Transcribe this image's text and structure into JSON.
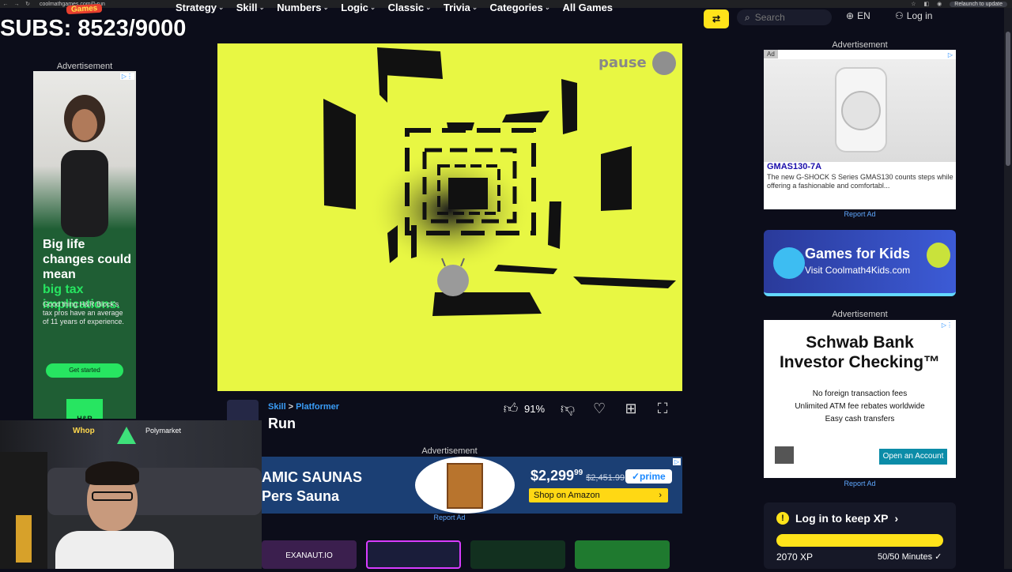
{
  "browser": {
    "url": "coolmathgames.com/0-run",
    "relaunch": "Relaunch to update"
  },
  "header": {
    "logo": "Games",
    "nav": [
      {
        "label": "Strategy"
      },
      {
        "label": "Skill"
      },
      {
        "label": "Numbers"
      },
      {
        "label": "Logic"
      },
      {
        "label": "Classic"
      },
      {
        "label": "Trivia"
      },
      {
        "label": "Categories"
      }
    ],
    "all_games": "All Games",
    "search_placeholder": "Search",
    "language": "EN",
    "login": "Log in"
  },
  "overlay": {
    "subs": "SUBS: 8523/9000"
  },
  "left_ad": {
    "label": "Advertisement",
    "headline_white": "Big life changes could mean",
    "headline_green": "big tax implications.",
    "body": "Good thing H&R Block's tax pros have an average of 11 years of experience.",
    "cta": "Get started",
    "brand": "H&R"
  },
  "game": {
    "pause_label": "pause",
    "breadcrumb_category": "Skill",
    "breadcrumb_sep": ">",
    "breadcrumb_sub": "Platformer",
    "title": "Run",
    "rating": "91%"
  },
  "mid_ad": {
    "label": "Advertisement",
    "headline": "AMIC SAUNAS Pers Sauna",
    "price_main": "$2,299",
    "price_cents": "99",
    "price_old": "$2,451.99",
    "prime": "✓prime",
    "shop": "Shop on Amazon",
    "report": "Report Ad"
  },
  "right_ad1": {
    "label": "Advertisement",
    "tag": "Ad",
    "name": "GMAS130-7A",
    "desc": "The new G-SHOCK S Series GMAS130 counts steps while offering a fashionable and comfortabl...",
    "report": "Report Ad"
  },
  "kids": {
    "title": "Games for Kids",
    "subtitle": "Visit Coolmath4Kids.com"
  },
  "right_ad2": {
    "label": "Advertisement",
    "headline1": "Schwab Bank",
    "headline2": "Investor Checking™",
    "lines": [
      "No foreign transaction fees",
      "Unlimited ATM fee rebates worldwide",
      "Easy cash transfers"
    ],
    "cta": "Open an Account",
    "report": "Report Ad"
  },
  "xp": {
    "title": "Log in to keep XP",
    "icon": "!",
    "points": "2070 XP",
    "minutes": "50/50 Minutes ✓",
    "progress": 1.0
  },
  "webcam": {
    "sponsor1": "Whop",
    "sponsor2": "Polymarket"
  },
  "bottom_tiles": {
    "label": "EXANAUT.IO"
  }
}
